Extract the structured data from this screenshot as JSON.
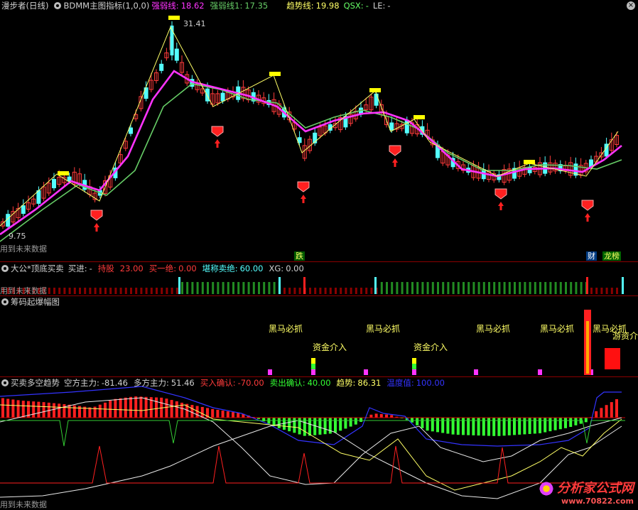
{
  "panel1": {
    "stock": "漫步者(日线)",
    "indicator": "BDMM主图指标(1,0,0)",
    "strong_label": "强弱线:",
    "strong_val": "18.62",
    "strong1_label": "强弱线1:",
    "strong1_val": "17.35",
    "trend_label": "趋势线:",
    "trend_val": "19.98",
    "qsx_label": "QSX:",
    "qsx_val": "-",
    "le_label": "LE:",
    "le_val": "-",
    "high_price": "31.41",
    "low_price": "9.75",
    "future": "用到未来数据",
    "tag_die": "跌",
    "tag_cai": "财",
    "tag_bang": "龙榜"
  },
  "panel2": {
    "title": "大公*顶底买卖",
    "buy_label": "买进:",
    "buy_val": "-",
    "hold_label": "持股",
    "hold_val": "23.00",
    "buy1_label": "买一绝:",
    "buy1_val": "0.00",
    "sell_label": "堪称卖绝:",
    "sell_val": "60.00",
    "xg_label": "XG:",
    "xg_val": "0.00",
    "future": "用到未来数据"
  },
  "panel3": {
    "title": "筹码起爆幅图",
    "heima": "黑马必抓",
    "zijin": "资金介入",
    "youzi": "游资介入"
  },
  "panel4": {
    "title": "买卖多空趋势",
    "short_label": "空方主力:",
    "short_val": "-81.46",
    "long_label": "多方主力:",
    "long_val": "51.46",
    "buyc_label": "买入确认:",
    "buyc_val": "-70.00",
    "sellc_label": "卖出确认:",
    "sellc_val": "40.00",
    "trend_label": "趋势:",
    "trend_val": "86.31",
    "temp_label": "温度值:",
    "temp_val": "100.00",
    "future": "用到未来数据"
  },
  "watermark": {
    "name": "分析家公式网",
    "url": "www.70822.com"
  },
  "colors": {
    "up": "#ff3b3b",
    "down": "#54ffff",
    "ma_magenta": "#ff33ff",
    "ma_green": "#66cc66",
    "yellow": "#ffff66",
    "green_bar": "#33ff33",
    "blue": "#3333ff"
  }
}
